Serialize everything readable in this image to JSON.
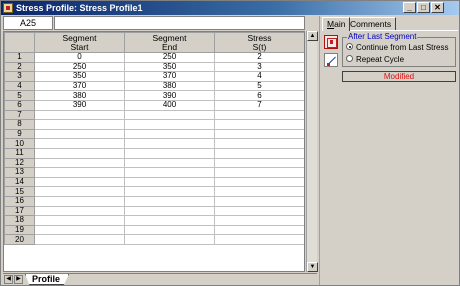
{
  "window": {
    "title": "Stress Profile: Stress Profile1",
    "buttons": [
      "_",
      "□",
      "✕"
    ]
  },
  "formula": {
    "cell_ref": "A25",
    "value": ""
  },
  "grid": {
    "headers": [
      {
        "line1": "Segment",
        "line2": "Start"
      },
      {
        "line1": "Segment",
        "line2": "End"
      },
      {
        "line1": "Stress",
        "line2": "S(t)"
      }
    ],
    "rows": [
      {
        "num": "1",
        "start": "0",
        "end": "250",
        "stress": "2"
      },
      {
        "num": "2",
        "start": "250",
        "end": "350",
        "stress": "3"
      },
      {
        "num": "3",
        "start": "350",
        "end": "370",
        "stress": "4"
      },
      {
        "num": "4",
        "start": "370",
        "end": "380",
        "stress": "5"
      },
      {
        "num": "5",
        "start": "380",
        "end": "390",
        "stress": "6"
      },
      {
        "num": "6",
        "start": "390",
        "end": "400",
        "stress": "7"
      },
      {
        "num": "7",
        "start": "",
        "end": "",
        "stress": ""
      },
      {
        "num": "8",
        "start": "",
        "end": "",
        "stress": ""
      },
      {
        "num": "9",
        "start": "",
        "end": "",
        "stress": ""
      },
      {
        "num": "10",
        "start": "",
        "end": "",
        "stress": ""
      },
      {
        "num": "11",
        "start": "",
        "end": "",
        "stress": ""
      },
      {
        "num": "12",
        "start": "",
        "end": "",
        "stress": ""
      },
      {
        "num": "13",
        "start": "",
        "end": "",
        "stress": ""
      },
      {
        "num": "14",
        "start": "",
        "end": "",
        "stress": ""
      },
      {
        "num": "15",
        "start": "",
        "end": "",
        "stress": ""
      },
      {
        "num": "16",
        "start": "",
        "end": "",
        "stress": ""
      },
      {
        "num": "17",
        "start": "",
        "end": "",
        "stress": ""
      },
      {
        "num": "18",
        "start": "",
        "end": "",
        "stress": ""
      },
      {
        "num": "19",
        "start": "",
        "end": "",
        "stress": ""
      },
      {
        "num": "20",
        "start": "",
        "end": "",
        "stress": ""
      }
    ]
  },
  "sheet_tabs": {
    "active": "Profile",
    "nav": [
      "◀",
      "▶"
    ]
  },
  "scroll": {
    "up": "▲",
    "down": "▼"
  },
  "panel": {
    "tabs": {
      "main_first": "M",
      "main_rest": "ain",
      "comments": "Comments"
    },
    "group_title": "After Last Segment",
    "options": [
      {
        "label": "Continue from Last Stress",
        "selected": true
      },
      {
        "label": "Repeat Cycle",
        "selected": false
      }
    ],
    "status": "Modified",
    "status_color": "#e01010",
    "icons": [
      "chart-icon",
      "edit-icon"
    ]
  }
}
